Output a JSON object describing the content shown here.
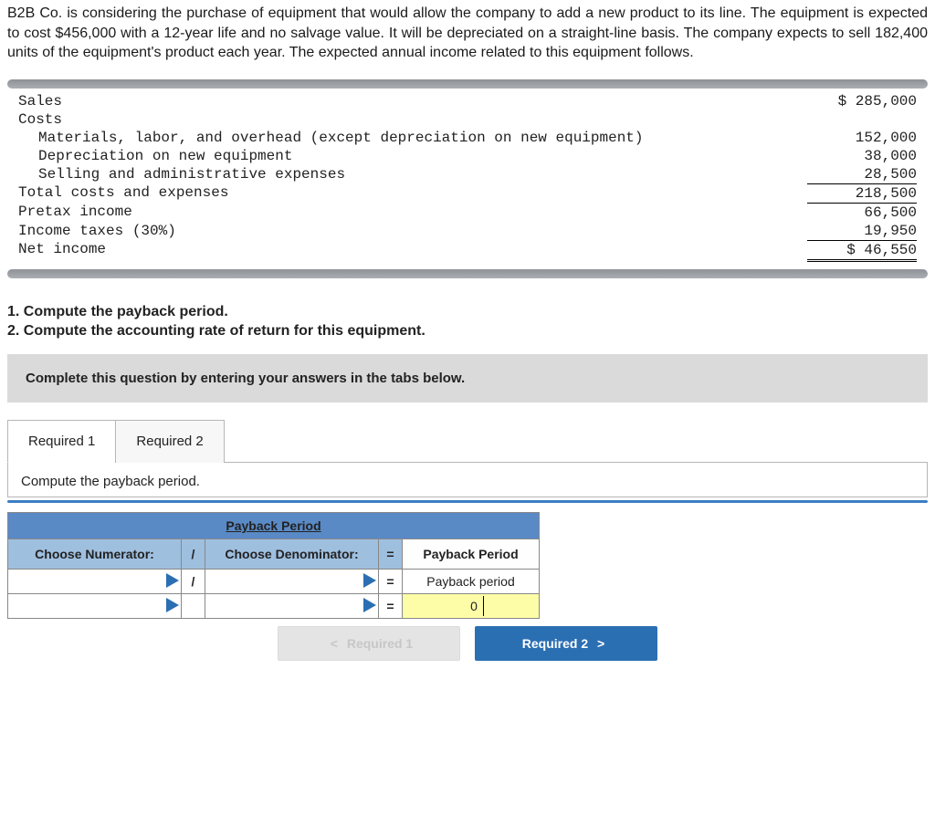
{
  "problem": "B2B Co. is considering the purchase of equipment that would allow the company to add a new product to its line. The equipment is expected to cost $456,000 with a 12-year life and no salvage value. It will be depreciated on a straight-line basis. The company expects to sell 182,400 units of the equipment's product each year. The expected annual income related to this equipment follows.",
  "income": {
    "sales_label": "Sales",
    "sales_value": "$ 285,000",
    "costs_label": "Costs",
    "materials_label": "Materials, labor, and overhead (except depreciation on new equipment)",
    "materials_value": "152,000",
    "depreciation_label": "Depreciation on new equipment",
    "depreciation_value": "38,000",
    "selling_label": "Selling and administrative expenses",
    "selling_value": "28,500",
    "total_costs_label": "Total costs and expenses",
    "total_costs_value": "218,500",
    "pretax_label": "Pretax income",
    "pretax_value": "66,500",
    "taxes_label": "Income taxes (30%)",
    "taxes_value": "19,950",
    "net_label": "Net income",
    "net_value": "$  46,550"
  },
  "questions": {
    "q1": "1. Compute the payback period.",
    "q2": "2. Compute the accounting rate of return for this equipment."
  },
  "banner": "Complete this question by entering your answers in the tabs below.",
  "tabs": {
    "t1": "Required 1",
    "t2": "Required 2"
  },
  "tab_instruction": "Compute the payback period.",
  "table": {
    "title": "Payback Period",
    "numerator": "Choose Numerator:",
    "divide": "/",
    "denominator": "Choose Denominator:",
    "equals": "=",
    "result_header": "Payback Period",
    "result_label": "Payback period",
    "result_value": "0"
  },
  "nav": {
    "prev": "Required 1",
    "next": "Required 2"
  }
}
